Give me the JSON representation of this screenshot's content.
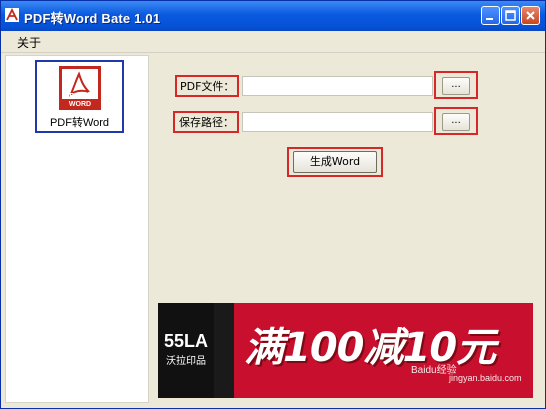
{
  "window": {
    "title": "PDF转Word Bate 1.01",
    "colors": {
      "titlebar": "#0a59e0",
      "highlight_red": "#d62828",
      "selection_blue": "#1f3aa8",
      "banner_red": "#c8102e"
    }
  },
  "menu": {
    "items": [
      "关于"
    ]
  },
  "sidebar": {
    "items": [
      {
        "label": "PDF转Word",
        "icon_text": "PDF转WORD",
        "icon": "pdf-icon"
      }
    ]
  },
  "form": {
    "pdf_file_label": "PDF文件：",
    "pdf_file_value": "",
    "save_path_label": "保存路径：",
    "save_path_value": "",
    "browse_label": "...",
    "generate_label": "生成Word"
  },
  "banner": {
    "logo": "55LA",
    "sub": "沃拉印品",
    "promo": "满100减10元"
  },
  "watermark": {
    "brand": "Baidu经验",
    "url": "jingyan.baidu.com"
  }
}
